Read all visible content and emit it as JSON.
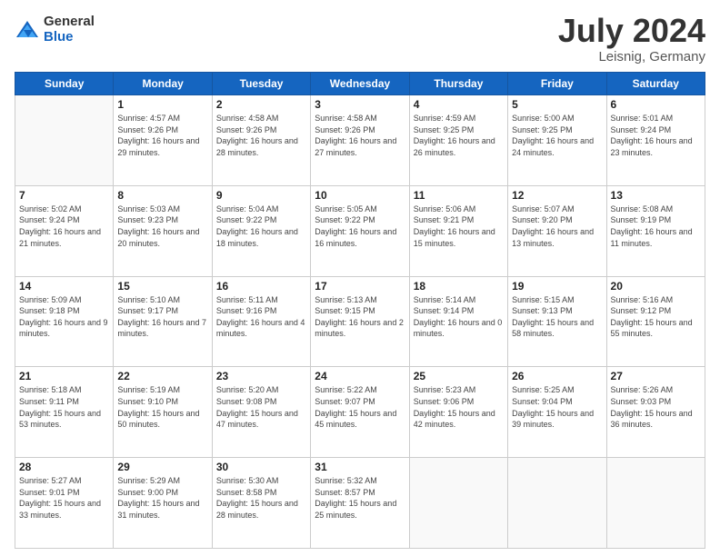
{
  "logo": {
    "general": "General",
    "blue": "Blue"
  },
  "title": {
    "month": "July 2024",
    "location": "Leisnig, Germany"
  },
  "headers": [
    "Sunday",
    "Monday",
    "Tuesday",
    "Wednesday",
    "Thursday",
    "Friday",
    "Saturday"
  ],
  "weeks": [
    [
      {
        "day": "",
        "sunrise": "",
        "sunset": "",
        "daylight": ""
      },
      {
        "day": "1",
        "sunrise": "Sunrise: 4:57 AM",
        "sunset": "Sunset: 9:26 PM",
        "daylight": "Daylight: 16 hours and 29 minutes."
      },
      {
        "day": "2",
        "sunrise": "Sunrise: 4:58 AM",
        "sunset": "Sunset: 9:26 PM",
        "daylight": "Daylight: 16 hours and 28 minutes."
      },
      {
        "day": "3",
        "sunrise": "Sunrise: 4:58 AM",
        "sunset": "Sunset: 9:26 PM",
        "daylight": "Daylight: 16 hours and 27 minutes."
      },
      {
        "day": "4",
        "sunrise": "Sunrise: 4:59 AM",
        "sunset": "Sunset: 9:25 PM",
        "daylight": "Daylight: 16 hours and 26 minutes."
      },
      {
        "day": "5",
        "sunrise": "Sunrise: 5:00 AM",
        "sunset": "Sunset: 9:25 PM",
        "daylight": "Daylight: 16 hours and 24 minutes."
      },
      {
        "day": "6",
        "sunrise": "Sunrise: 5:01 AM",
        "sunset": "Sunset: 9:24 PM",
        "daylight": "Daylight: 16 hours and 23 minutes."
      }
    ],
    [
      {
        "day": "7",
        "sunrise": "Sunrise: 5:02 AM",
        "sunset": "Sunset: 9:24 PM",
        "daylight": "Daylight: 16 hours and 21 minutes."
      },
      {
        "day": "8",
        "sunrise": "Sunrise: 5:03 AM",
        "sunset": "Sunset: 9:23 PM",
        "daylight": "Daylight: 16 hours and 20 minutes."
      },
      {
        "day": "9",
        "sunrise": "Sunrise: 5:04 AM",
        "sunset": "Sunset: 9:22 PM",
        "daylight": "Daylight: 16 hours and 18 minutes."
      },
      {
        "day": "10",
        "sunrise": "Sunrise: 5:05 AM",
        "sunset": "Sunset: 9:22 PM",
        "daylight": "Daylight: 16 hours and 16 minutes."
      },
      {
        "day": "11",
        "sunrise": "Sunrise: 5:06 AM",
        "sunset": "Sunset: 9:21 PM",
        "daylight": "Daylight: 16 hours and 15 minutes."
      },
      {
        "day": "12",
        "sunrise": "Sunrise: 5:07 AM",
        "sunset": "Sunset: 9:20 PM",
        "daylight": "Daylight: 16 hours and 13 minutes."
      },
      {
        "day": "13",
        "sunrise": "Sunrise: 5:08 AM",
        "sunset": "Sunset: 9:19 PM",
        "daylight": "Daylight: 16 hours and 11 minutes."
      }
    ],
    [
      {
        "day": "14",
        "sunrise": "Sunrise: 5:09 AM",
        "sunset": "Sunset: 9:18 PM",
        "daylight": "Daylight: 16 hours and 9 minutes."
      },
      {
        "day": "15",
        "sunrise": "Sunrise: 5:10 AM",
        "sunset": "Sunset: 9:17 PM",
        "daylight": "Daylight: 16 hours and 7 minutes."
      },
      {
        "day": "16",
        "sunrise": "Sunrise: 5:11 AM",
        "sunset": "Sunset: 9:16 PM",
        "daylight": "Daylight: 16 hours and 4 minutes."
      },
      {
        "day": "17",
        "sunrise": "Sunrise: 5:13 AM",
        "sunset": "Sunset: 9:15 PM",
        "daylight": "Daylight: 16 hours and 2 minutes."
      },
      {
        "day": "18",
        "sunrise": "Sunrise: 5:14 AM",
        "sunset": "Sunset: 9:14 PM",
        "daylight": "Daylight: 16 hours and 0 minutes."
      },
      {
        "day": "19",
        "sunrise": "Sunrise: 5:15 AM",
        "sunset": "Sunset: 9:13 PM",
        "daylight": "Daylight: 15 hours and 58 minutes."
      },
      {
        "day": "20",
        "sunrise": "Sunrise: 5:16 AM",
        "sunset": "Sunset: 9:12 PM",
        "daylight": "Daylight: 15 hours and 55 minutes."
      }
    ],
    [
      {
        "day": "21",
        "sunrise": "Sunrise: 5:18 AM",
        "sunset": "Sunset: 9:11 PM",
        "daylight": "Daylight: 15 hours and 53 minutes."
      },
      {
        "day": "22",
        "sunrise": "Sunrise: 5:19 AM",
        "sunset": "Sunset: 9:10 PM",
        "daylight": "Daylight: 15 hours and 50 minutes."
      },
      {
        "day": "23",
        "sunrise": "Sunrise: 5:20 AM",
        "sunset": "Sunset: 9:08 PM",
        "daylight": "Daylight: 15 hours and 47 minutes."
      },
      {
        "day": "24",
        "sunrise": "Sunrise: 5:22 AM",
        "sunset": "Sunset: 9:07 PM",
        "daylight": "Daylight: 15 hours and 45 minutes."
      },
      {
        "day": "25",
        "sunrise": "Sunrise: 5:23 AM",
        "sunset": "Sunset: 9:06 PM",
        "daylight": "Daylight: 15 hours and 42 minutes."
      },
      {
        "day": "26",
        "sunrise": "Sunrise: 5:25 AM",
        "sunset": "Sunset: 9:04 PM",
        "daylight": "Daylight: 15 hours and 39 minutes."
      },
      {
        "day": "27",
        "sunrise": "Sunrise: 5:26 AM",
        "sunset": "Sunset: 9:03 PM",
        "daylight": "Daylight: 15 hours and 36 minutes."
      }
    ],
    [
      {
        "day": "28",
        "sunrise": "Sunrise: 5:27 AM",
        "sunset": "Sunset: 9:01 PM",
        "daylight": "Daylight: 15 hours and 33 minutes."
      },
      {
        "day": "29",
        "sunrise": "Sunrise: 5:29 AM",
        "sunset": "Sunset: 9:00 PM",
        "daylight": "Daylight: 15 hours and 31 minutes."
      },
      {
        "day": "30",
        "sunrise": "Sunrise: 5:30 AM",
        "sunset": "Sunset: 8:58 PM",
        "daylight": "Daylight: 15 hours and 28 minutes."
      },
      {
        "day": "31",
        "sunrise": "Sunrise: 5:32 AM",
        "sunset": "Sunset: 8:57 PM",
        "daylight": "Daylight: 15 hours and 25 minutes."
      },
      {
        "day": "",
        "sunrise": "",
        "sunset": "",
        "daylight": ""
      },
      {
        "day": "",
        "sunrise": "",
        "sunset": "",
        "daylight": ""
      },
      {
        "day": "",
        "sunrise": "",
        "sunset": "",
        "daylight": ""
      }
    ]
  ]
}
